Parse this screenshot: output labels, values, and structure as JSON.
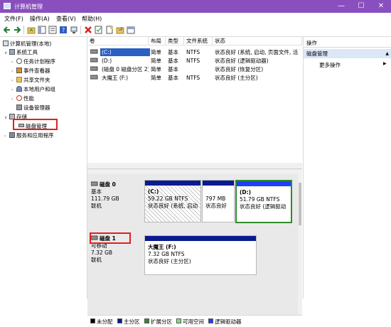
{
  "window": {
    "title": "计算机管理",
    "controls": {
      "minimize": "—",
      "maximize": "☐",
      "close": "✕"
    }
  },
  "menu": [
    "文件(F)",
    "操作(A)",
    "查看(V)",
    "帮助(H)"
  ],
  "toolbar_icons": [
    "back-arrow-icon",
    "forward-arrow-icon",
    "up-folder-icon",
    "show-tree-icon",
    "properties-icon",
    "help-icon",
    "connect-icon",
    "delete-icon",
    "check-icon",
    "new-icon",
    "refresh-icon",
    "export-icon"
  ],
  "tree": {
    "root": "计算机管理(本地)",
    "system_tools": "系统工具",
    "task_scheduler": "任务计划程序",
    "event_viewer": "事件查看器",
    "shared_folders": "共享文件夹",
    "local_users": "本地用户和组",
    "performance": "性能",
    "device_manager": "设备管理器",
    "storage": "存储",
    "disk_management": "磁盘管理",
    "services": "服务和应用程序"
  },
  "volume_table": {
    "headers": [
      "卷",
      "布局",
      "类型",
      "文件系统",
      "状态"
    ],
    "rows": [
      {
        "volume": "(C:)",
        "layout": "简单",
        "type": "基本",
        "fs": "NTFS",
        "status": "状态良好 (系统, 启动, 页面文件, 活动"
      },
      {
        "volume": "(D:)",
        "layout": "简单",
        "type": "基本",
        "fs": "NTFS",
        "status": "状态良好 (逻辑驱动器)"
      },
      {
        "volume": "(磁盘 0 磁盘分区 2)",
        "layout": "简单",
        "type": "基本",
        "fs": "",
        "status": "状态良好 (恢复分区)"
      },
      {
        "volume": "大魔王 (F:)",
        "layout": "简单",
        "type": "基本",
        "fs": "NTFS",
        "status": "状态良好 (主分区)"
      }
    ]
  },
  "disks": [
    {
      "name": "磁盘 0",
      "kind": "基本",
      "size": "111.79 GB",
      "state": "联机",
      "partitions": [
        {
          "label": "(C:)",
          "size": "59.22 GB NTFS",
          "status": "状态良好 (系统, 启动"
        },
        {
          "label": "",
          "size": "797 MB",
          "status": "状态良好"
        },
        {
          "label": "(D:)",
          "size": "51.79 GB NTFS",
          "status": "状态良好 (逻辑驱动"
        }
      ]
    },
    {
      "name": "磁盘 1",
      "kind": "可移动",
      "size": "7.32 GB",
      "state": "联机",
      "partitions": [
        {
          "label": "大魔王 (F:)",
          "size": "7.32 GB NTFS",
          "status": "状态良好 (主分区)"
        }
      ]
    }
  ],
  "legend": [
    {
      "label": "未分配",
      "color": "#000000"
    },
    {
      "label": "主分区",
      "color": "#0a1a8f"
    },
    {
      "label": "扩展分区",
      "color": "#2e8b2e"
    },
    {
      "label": "可用空间",
      "color": "#7fe07f"
    },
    {
      "label": "逻辑驱动器",
      "color": "#1f3fff"
    }
  ],
  "actions": {
    "header": "操作",
    "section": "磁盘管理",
    "more": "更多操作"
  }
}
